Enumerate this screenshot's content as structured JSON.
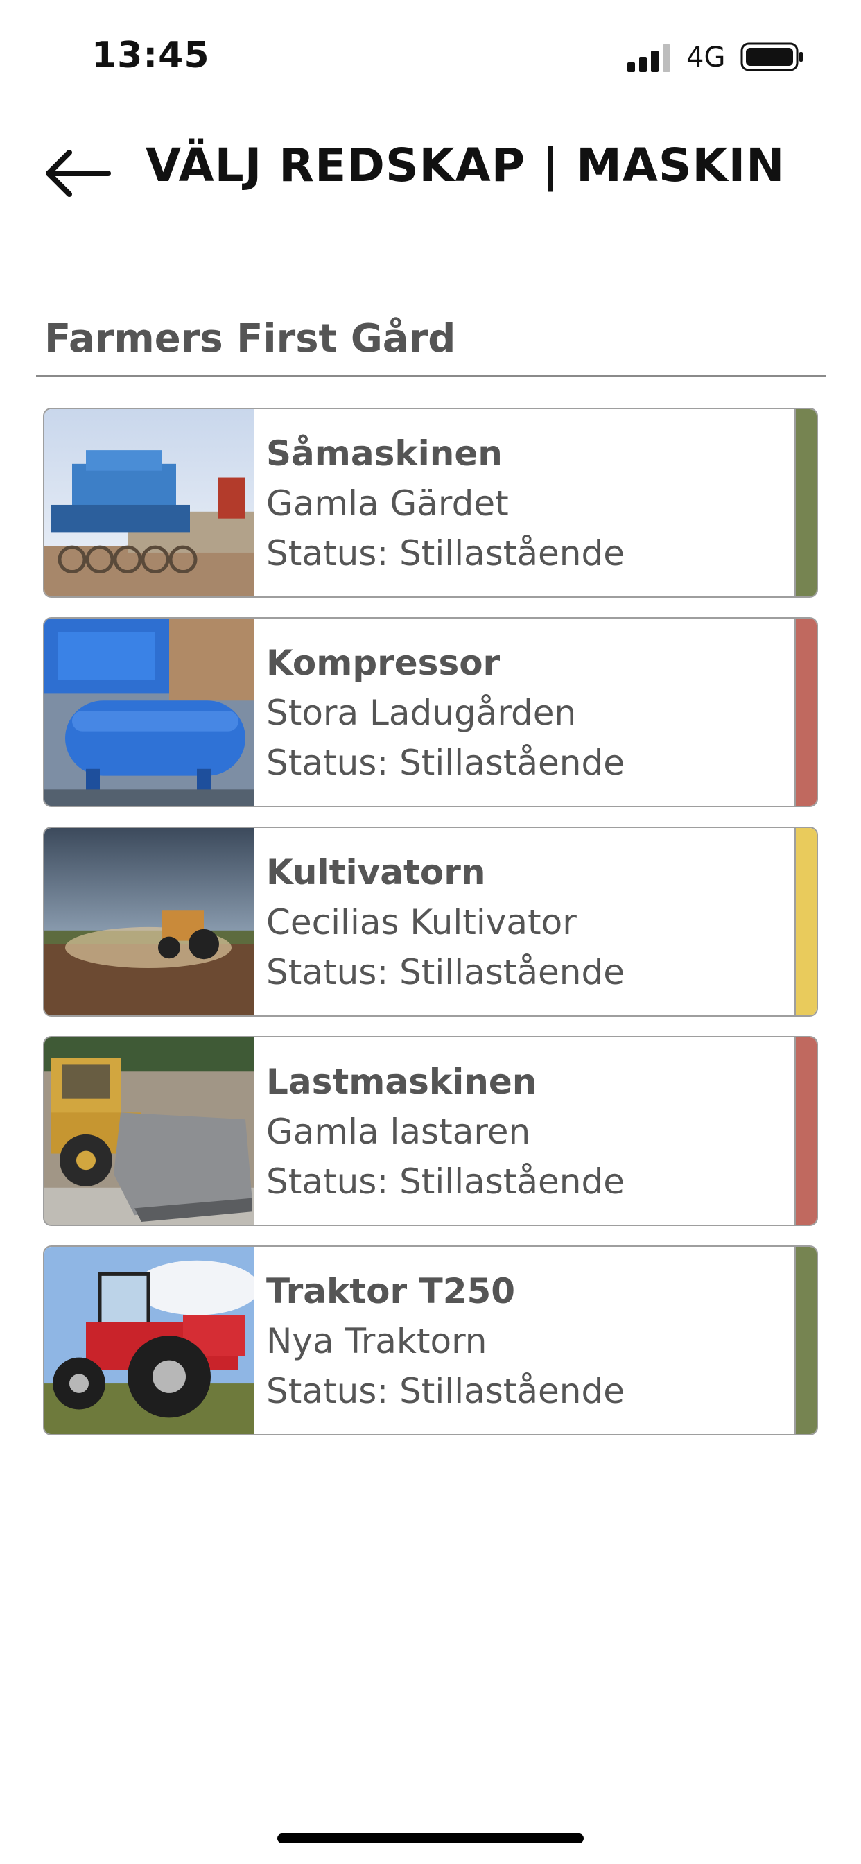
{
  "status_bar": {
    "time": "13:45",
    "network": "4G",
    "icons": [
      "signal-icon",
      "battery-icon"
    ]
  },
  "header": {
    "back_icon": "arrow-left-icon",
    "title": "VÄLJ REDSKAP | MASKIN"
  },
  "farm": {
    "name": "Farmers First Gård"
  },
  "machines": [
    {
      "name": "Såmaskinen",
      "location": "Gamla Gärdet",
      "status": "Status: Stillastående",
      "status_color": "#768451",
      "image": "seed-drill-image"
    },
    {
      "name": "Kompressor",
      "location": "Stora Ladugården",
      "status": "Status: Stillastående",
      "status_color": "#c0695f",
      "image": "compressor-image"
    },
    {
      "name": "Kultivatorn",
      "location": "Cecilias Kultivator",
      "status": "Status: Stillastående",
      "status_color": "#e9cb5c",
      "image": "cultivator-image"
    },
    {
      "name": "Lastmaskinen",
      "location": "Gamla lastaren",
      "status": "Status: Stillastående",
      "status_color": "#c0695f",
      "image": "wheel-loader-image"
    },
    {
      "name": "Traktor T250",
      "location": "Nya Traktorn",
      "status": "Status: Stillastående",
      "status_color": "#768451",
      "image": "tractor-image"
    }
  ]
}
